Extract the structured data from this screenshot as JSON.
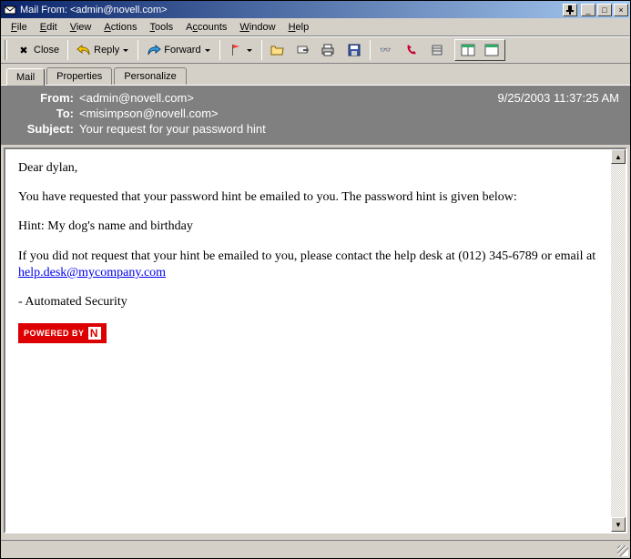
{
  "titlebar": {
    "text": "Mail From: <admin@novell.com>"
  },
  "menubar": {
    "items": [
      {
        "label": "File",
        "accel": "F"
      },
      {
        "label": "Edit",
        "accel": "E"
      },
      {
        "label": "View",
        "accel": "V"
      },
      {
        "label": "Actions",
        "accel": "A"
      },
      {
        "label": "Tools",
        "accel": "T"
      },
      {
        "label": "Accounts",
        "accel": "c"
      },
      {
        "label": "Window",
        "accel": "W"
      },
      {
        "label": "Help",
        "accel": "H"
      }
    ]
  },
  "toolbar": {
    "close": "Close",
    "reply": "Reply",
    "forward": "Forward"
  },
  "tabs": {
    "items": [
      {
        "label": "Mail",
        "active": true
      },
      {
        "label": "Properties",
        "active": false
      },
      {
        "label": "Personalize",
        "active": false
      }
    ]
  },
  "header": {
    "from_label": "From:",
    "from_value": "<admin@novell.com>",
    "to_label": "To:",
    "to_value": "<misimpson@novell.com>",
    "subject_label": "Subject:",
    "subject_value": "Your request for your password hint",
    "date": "9/25/2003 11:37:25 AM"
  },
  "body": {
    "greeting": "Dear dylan,",
    "line1": "You have requested that your password hint be emailed to you. The password hint is given below:",
    "hint": "Hint: My dog's name and birthday",
    "line2a": "If you did not request that your hint be emailed to you, please contact the help desk at (012) 345-6789 or email at ",
    "helpdesk_link": "help.desk@mycompany.com",
    "signature": "- Automated Security",
    "badge_text": "POWERED BY",
    "badge_n": "N"
  }
}
